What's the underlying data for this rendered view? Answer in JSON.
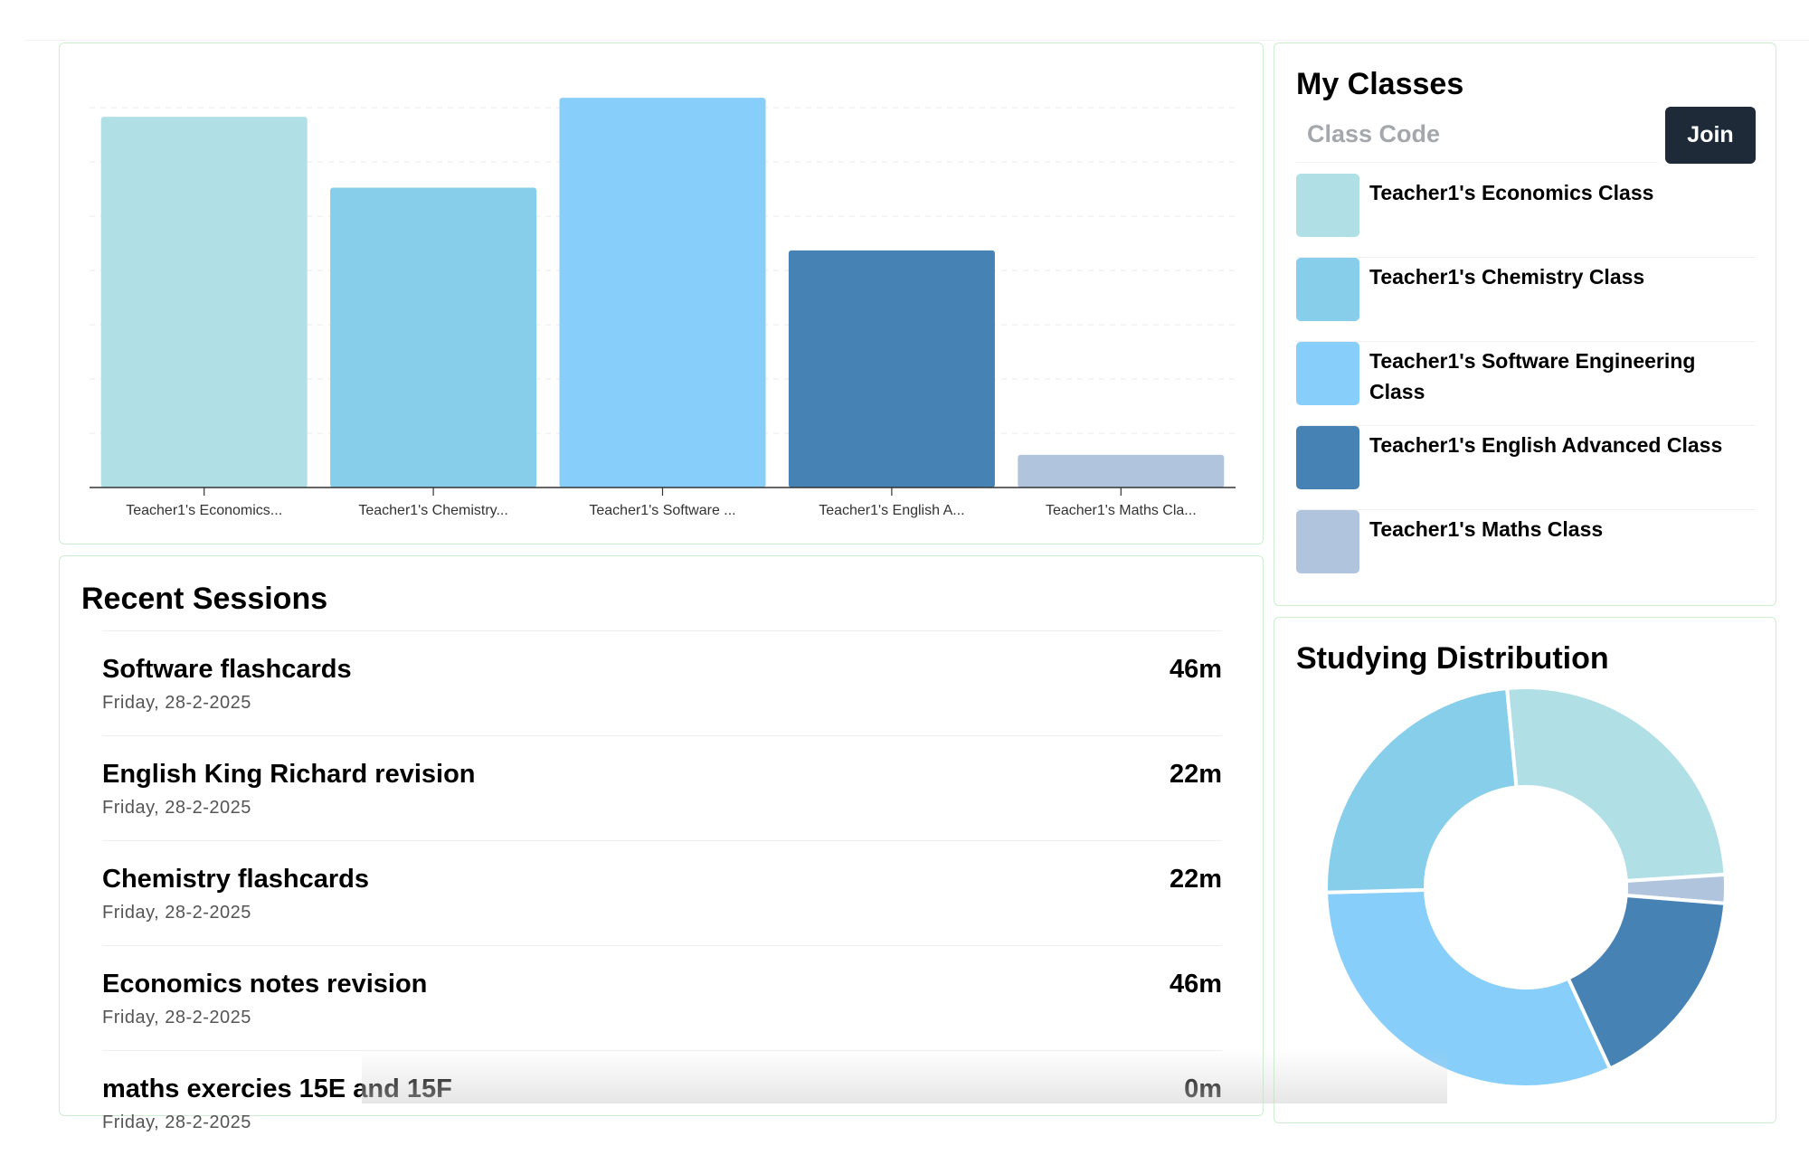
{
  "colors": {
    "economics": "#b0e0e6",
    "chemistry": "#87ceeb",
    "software": "#87cefa",
    "english": "#4682b4",
    "maths": "#b0c4de",
    "join_button": "#1e2a38",
    "card_border": "#cdeecf"
  },
  "chart_data": [
    {
      "type": "bar",
      "categories": [
        "Teacher1's Economics...",
        "Teacher1's Chemistry...",
        "Teacher1's Software ...",
        "Teacher1's English A...",
        "Teacher1's Maths Cla..."
      ],
      "values": [
        68,
        55,
        71.5,
        43.5,
        6
      ],
      "colors": [
        "#b0e0e6",
        "#87ceeb",
        "#87cefa",
        "#4682b4",
        "#b0c4de"
      ],
      "ylim": [
        0,
        75
      ],
      "grid": true
    },
    {
      "type": "pie",
      "title": "Studying Distribution",
      "variant": "donut",
      "labels": [
        "Teacher1's Economics Class",
        "Teacher1's Maths Class",
        "Teacher1's English Advanced Class",
        "Teacher1's Software Engineering Class",
        "Teacher1's Chemistry Class"
      ],
      "values": [
        25.5,
        2.3,
        16.8,
        31.5,
        23.9
      ],
      "colors": [
        "#b0e0e6",
        "#b0c4de",
        "#4682b4",
        "#87cefa",
        "#87ceeb"
      ]
    }
  ],
  "sessions": {
    "title": "Recent Sessions",
    "items": [
      {
        "title": "Software flashcards",
        "date": "Friday, 28-2-2025",
        "duration": "46m"
      },
      {
        "title": "English King Richard revision",
        "date": "Friday, 28-2-2025",
        "duration": "22m"
      },
      {
        "title": "Chemistry flashcards",
        "date": "Friday, 28-2-2025",
        "duration": "22m"
      },
      {
        "title": "Economics notes revision",
        "date": "Friday, 28-2-2025",
        "duration": "46m"
      },
      {
        "title": "maths exercies 15E and 15F",
        "date": "Friday, 28-2-2025",
        "duration": "0m"
      }
    ]
  },
  "classes": {
    "title": "My Classes",
    "input_placeholder": "Class Code",
    "join_label": "Join",
    "items": [
      {
        "name": "Teacher1's Economics Class",
        "color": "#b0e0e6"
      },
      {
        "name": "Teacher1's Chemistry Class",
        "color": "#87ceeb"
      },
      {
        "name": "Teacher1's Software Engineering Class",
        "color": "#87cefa"
      },
      {
        "name": "Teacher1's English Advanced Class",
        "color": "#4682b4"
      },
      {
        "name": "Teacher1's Maths Class",
        "color": "#b0c4de"
      }
    ]
  }
}
